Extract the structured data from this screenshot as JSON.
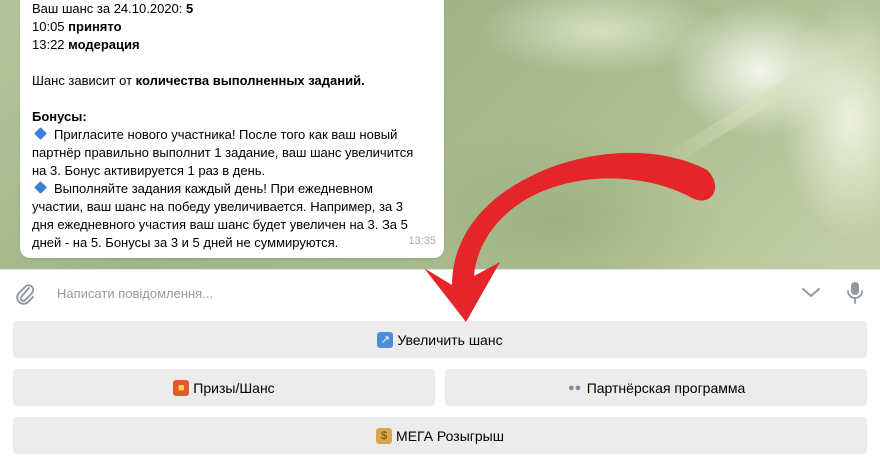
{
  "message": {
    "lines": [
      {
        "prefix": "Ваш шанс за 24.10.2020: ",
        "bold": "5",
        "suffix": ""
      },
      {
        "prefix": "10:05 ",
        "bold": "принято",
        "suffix": ""
      },
      {
        "prefix": "13:22 ",
        "bold": "модерация",
        "suffix": ""
      },
      {
        "prefix": "Шанс зависит от ",
        "bold": "количества выполненных заданий.",
        "suffix": ""
      },
      {
        "prefix": "",
        "bold": "Бонусы:",
        "suffix": ""
      }
    ],
    "bonus1_lines": [
      "Пригласите нового участника! После того как ваш новый",
      "партнёр правильно выполнит 1 задание, ваш шанс увеличится",
      "на 3. Бонус активируется 1 раз в день."
    ],
    "bonus2_lines": [
      "Выполняйте задания каждый день! При ежедневном",
      "участии, ваш шанс на победу увеличивается. Например, за 3",
      "дня ежедневного участия ваш шанс будет увеличен на 3. За 5",
      "дней - на 5. Бонусы за 3 и 5 дней не суммируются."
    ],
    "time": "13:35"
  },
  "input": {
    "placeholder": "Написати повідомлення..."
  },
  "keyboard": {
    "increase_label": "Увеличить шанс",
    "prizes_label": "Призы/Шанс",
    "partner_label": "Партнёрская программа",
    "mega_label": "МЕГА Розыгрыш"
  },
  "icons": [
    "paperclip-icon",
    "chevron-down-icon",
    "microphone-icon",
    "diamond-icon",
    "arrow-up-right-icon",
    "gift-icon",
    "people-icon",
    "money-bag-icon"
  ],
  "colors": {
    "arrow": "#e5252a",
    "button_bg": "#ececec",
    "diamond": "#3b7fd6",
    "placeholder": "#999999"
  }
}
